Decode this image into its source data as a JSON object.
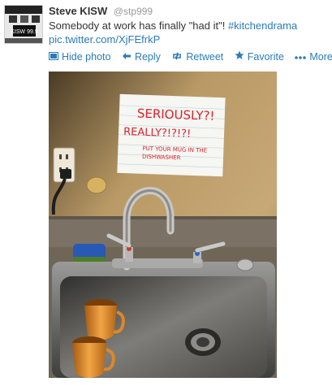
{
  "tweet": {
    "name": "Steve KISW",
    "handle": "@stp999",
    "text_prefix": "Somebody at work has finally \"had it\"! ",
    "hashtag": "#kitchendrama",
    "link": "pic.twitter.com/XjFEfrkP"
  },
  "avatar": {
    "caption": "KISW 99.9"
  },
  "actions": {
    "hide_photo": "Hide photo",
    "reply": "Reply",
    "retweet": "Retweet",
    "favorite": "Favorite",
    "more": "More"
  },
  "photo": {
    "note_line1": "SERIOUSLY?!",
    "note_line2": "REALLY?!?!?!",
    "note_line3": "PUT YOUR MUG IN THE",
    "note_line4": "DISHWASHER"
  },
  "colors": {
    "link": "#2b7bb9",
    "note_ink": "#d8232a"
  },
  "icons": [
    "photo-icon",
    "reply-arrow-icon",
    "retweet-icon",
    "star-icon",
    "more-dots-icon"
  ]
}
